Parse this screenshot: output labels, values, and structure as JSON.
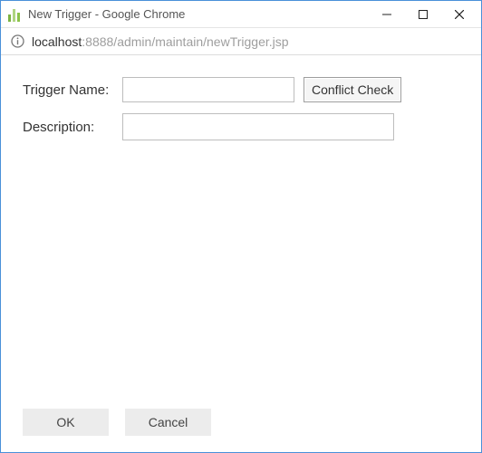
{
  "window": {
    "title": "New Trigger - Google Chrome"
  },
  "address": {
    "host": "localhost",
    "rest": ":8888/admin/maintain/newTrigger.jsp"
  },
  "form": {
    "triggerNameLabel": "Trigger Name:",
    "triggerNameValue": "",
    "conflictCheckLabel": "Conflict Check",
    "descriptionLabel": "Description:",
    "descriptionValue": ""
  },
  "footer": {
    "okLabel": "OK",
    "cancelLabel": "Cancel"
  }
}
